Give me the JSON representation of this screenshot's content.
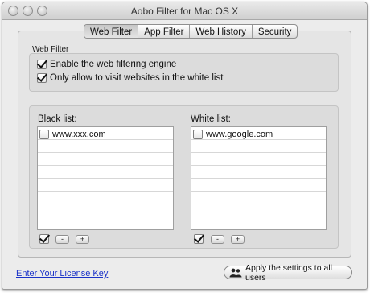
{
  "window": {
    "title": "Aobo Filter for Mac OS X"
  },
  "tabs": [
    {
      "label": "Web Filter",
      "active": true
    },
    {
      "label": "App Filter",
      "active": false
    },
    {
      "label": "Web History",
      "active": false
    },
    {
      "label": "Security",
      "active": false
    }
  ],
  "web_filter": {
    "section_label": "Web Filter",
    "options": [
      {
        "label": "Enable the web filtering engine",
        "checked": true
      },
      {
        "label": "Only allow to visit websites in the white list",
        "checked": true
      }
    ]
  },
  "black_list": {
    "title": "Black list:",
    "items": [
      {
        "url": "www.xxx.com",
        "checked": false
      }
    ],
    "select_all_checked": true,
    "remove_label": "-",
    "add_label": "+"
  },
  "white_list": {
    "title": "White list:",
    "items": [
      {
        "url": "www.google.com",
        "checked": false
      }
    ],
    "select_all_checked": true,
    "remove_label": "-",
    "add_label": "+"
  },
  "footer": {
    "license_link": "Enter Your License Key",
    "apply_button": "Apply the settings to all users",
    "apply_icon": "users-icon"
  },
  "colors": {
    "link": "#1a32c8"
  }
}
